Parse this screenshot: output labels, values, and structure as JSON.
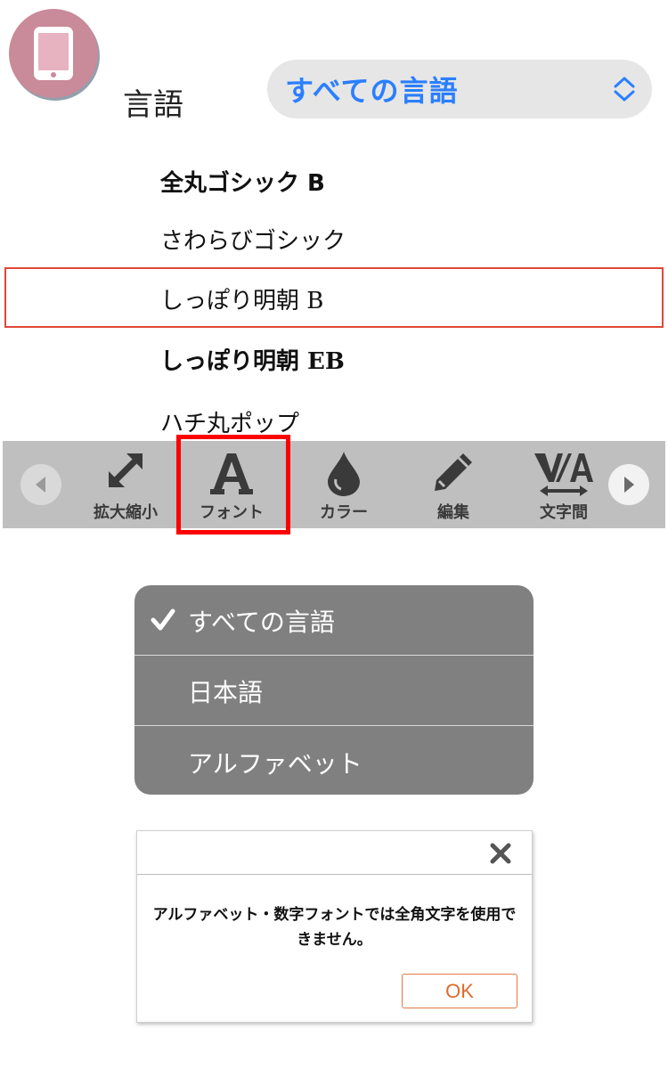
{
  "header": {
    "language_label": "言語",
    "language_select_value": "すべての言語"
  },
  "font_list": {
    "items": [
      "全丸ゴシック B",
      "さわらびゴシック",
      "しっぽり明朝 B",
      "しっぽり明朝 EB",
      "ハチ丸ポップ"
    ],
    "selected_index": 2
  },
  "toolbar": {
    "tools": [
      {
        "label": "拡大縮小",
        "icon": "resize-icon"
      },
      {
        "label": "フォント",
        "icon": "font-a-icon"
      },
      {
        "label": "カラー",
        "icon": "drop-icon"
      },
      {
        "label": "編集",
        "icon": "pencil-icon"
      },
      {
        "label": "文字間",
        "icon": "letter-spacing-icon"
      }
    ],
    "highlighted_tool": "フォント"
  },
  "language_dropdown": {
    "options": [
      "すべての言語",
      "日本語",
      "アルファベット"
    ],
    "selected": "すべての言語"
  },
  "dialog": {
    "message": "アルファベット・数字フォントでは全角文字を使用できません。",
    "ok_label": "OK"
  },
  "colors": {
    "accent_blue": "#2a7fff",
    "selection_border": "#e04838",
    "highlight_red": "#ff0000",
    "ok_orange": "#e06a2c",
    "badge_pink": "#c98a99"
  }
}
